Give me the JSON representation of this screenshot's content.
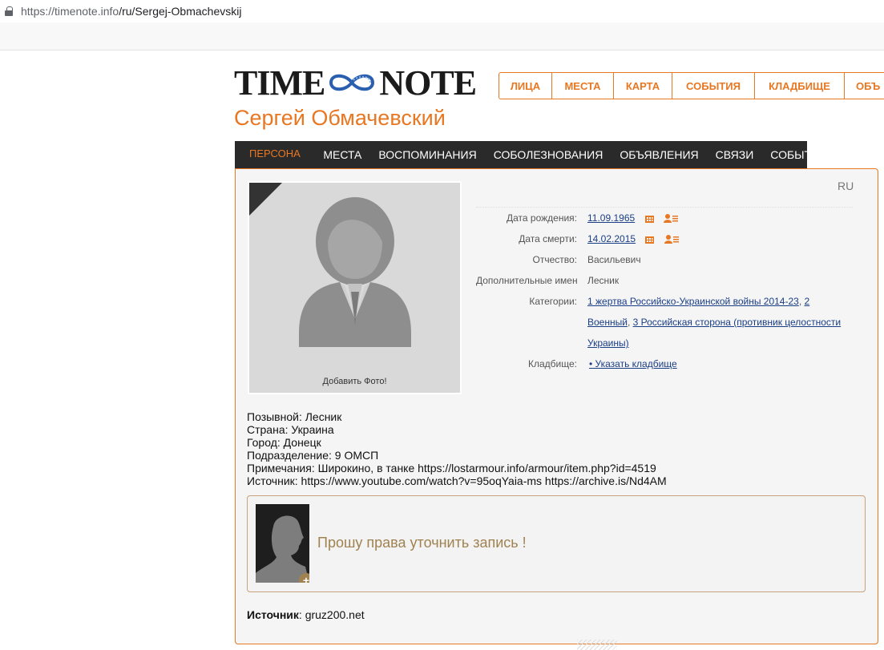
{
  "browser": {
    "url_host": "https://timenote.info",
    "url_path": "/ru/Sergej-Obmachevskij"
  },
  "logo": {
    "left": "TIME",
    "right": "NOTE"
  },
  "mainnav": [
    "Лица",
    "Места",
    "Карта",
    "События",
    "Кладбище",
    "Объ"
  ],
  "person_name": "Сергей Обмачевский",
  "tabs": [
    "ПЕРСОНА",
    "МЕСТА",
    "ВОСПОМИНАНИЯ",
    "СОБОЛЕЗНОВАНИЯ",
    "ОБЪЯВЛЕНИЯ",
    "СВЯЗИ",
    "СОБЫТИЯ"
  ],
  "lang": "RU",
  "photo": {
    "add_label": "Добавить Фото!"
  },
  "info": {
    "birth_label": "Дата рождения:",
    "birth_value": "11.09.1965",
    "death_label": "Дата смерти:",
    "death_value": "14.02.2015",
    "patronymic_label": "Отчество:",
    "patronymic_value": "Васильевич",
    "extra_names_label": "Дополнительные имен",
    "extra_names_value": "Лесник",
    "categories_label": "Категории:",
    "categories": [
      "1 жертва Российско-Украинской войны 2014-23",
      "2 Военный",
      "3 Российская сторона (противник целостности Украины)"
    ],
    "cemetery_label": "Кладбище:",
    "cemetery_value": "• Указать кладбище"
  },
  "details": [
    "Позывной: Лесник",
    "Страна: Украина",
    "Город: Донецк",
    "Подразделение: 9 ОМСП",
    "Примечания: Широкино, в танке https://lostarmour.info/armour/item.php?id=4519",
    "Источник: https://www.youtube.com/watch?v=95oqYaia-ms https://archive.is/Nd4AM"
  ],
  "ask": {
    "text": "Прошу права уточнить запись !",
    "plus": "+"
  },
  "source": {
    "label": "Источник",
    "value": ": gruz200.net"
  },
  "colors": {
    "accent": "#e87722",
    "link": "#1a3e86",
    "tabbar": "#2a2a2a",
    "ask_text": "#a08250"
  }
}
